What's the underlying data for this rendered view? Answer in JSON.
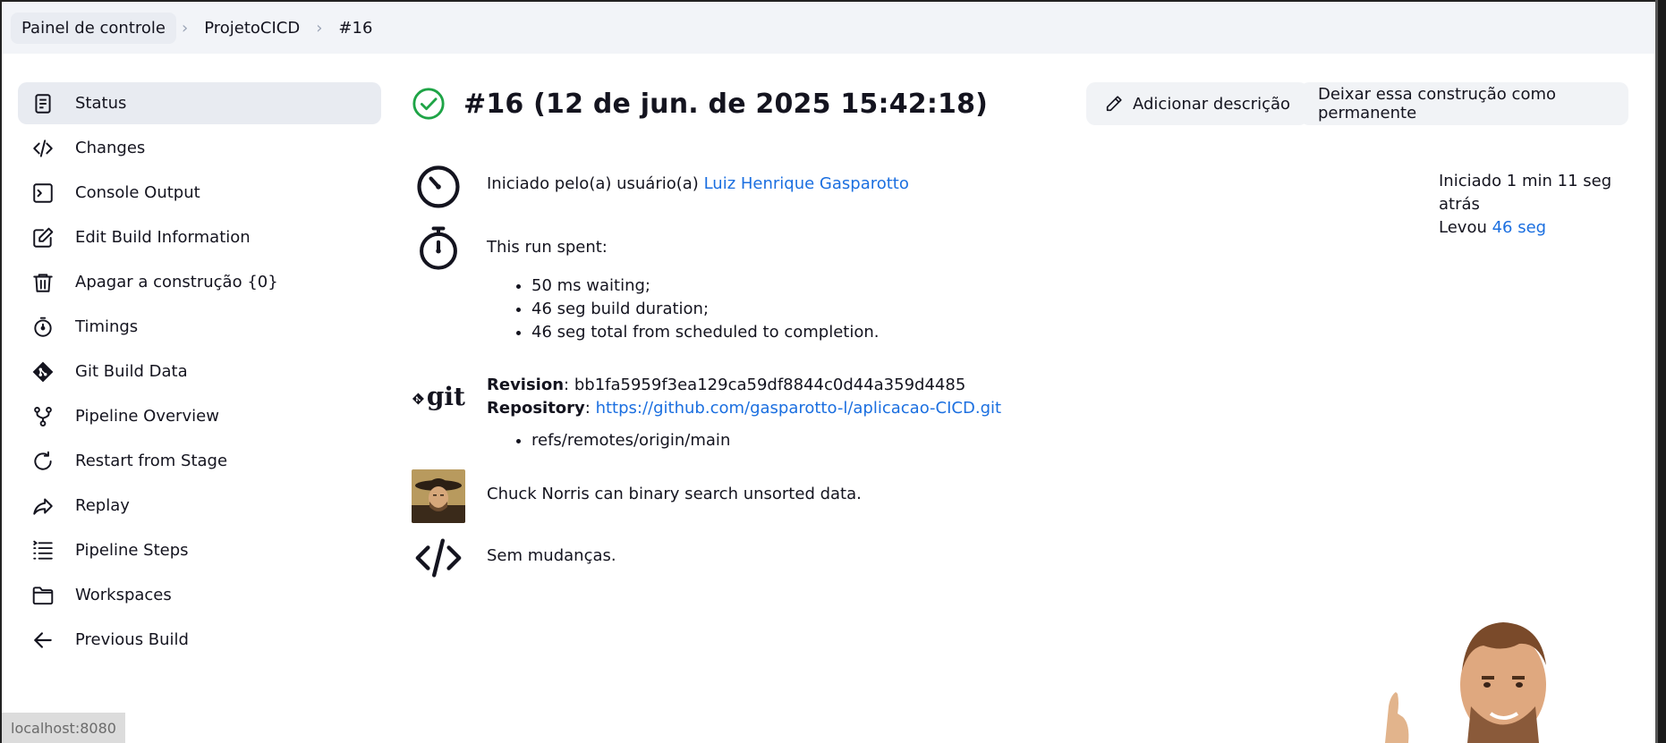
{
  "breadcrumb": {
    "items": [
      "Painel de controle",
      "ProjetoCICD",
      "#16"
    ]
  },
  "sidebar": {
    "items": [
      {
        "label": "Status",
        "icon": "status-doc-icon"
      },
      {
        "label": "Changes",
        "icon": "code-icon"
      },
      {
        "label": "Console Output",
        "icon": "terminal-icon"
      },
      {
        "label": "Edit Build Information",
        "icon": "edit-note-icon"
      },
      {
        "label": "Apagar a construção {0}",
        "icon": "trash-icon"
      },
      {
        "label": "Timings",
        "icon": "stopwatch-icon"
      },
      {
        "label": "Git Build Data",
        "icon": "git-diamond-icon"
      },
      {
        "label": "Pipeline Overview",
        "icon": "fork-icon"
      },
      {
        "label": "Restart from Stage",
        "icon": "refresh-icon"
      },
      {
        "label": "Replay",
        "icon": "share-arrow-icon"
      },
      {
        "label": "Pipeline Steps",
        "icon": "list-steps-icon"
      },
      {
        "label": "Workspaces",
        "icon": "folder-icon"
      },
      {
        "label": "Previous Build",
        "icon": "arrow-left-icon"
      }
    ]
  },
  "header": {
    "title": "#16 (12 de jun. de 2025 15:42:18)",
    "add_description": "Adicionar descrição",
    "keep_forever": "Deixar essa construção como permanente"
  },
  "info": {
    "started_by_prefix": "Iniciado pelo(a) usuário(a)",
    "started_by_user": "Luiz Henrique Gasparotto",
    "started_ago": "Iniciado 1 min 11 seg atrás",
    "took_prefix": "Levou",
    "took_value": "46 seg",
    "run_spent_label": "This run spent:",
    "run_spent_items": [
      "50 ms waiting;",
      "46 seg build duration;",
      "46 seg total from scheduled to completion."
    ],
    "git_logo_text": "git",
    "revision_label": "Revision",
    "revision_value": "bb1fa5959f3ea129ca59df8844c0d44a359d4485",
    "repository_label": "Repository",
    "repository_url": "https://github.com/gasparotto-l/aplicacao-CICD.git",
    "branches": [
      "refs/remotes/origin/main"
    ],
    "chuck_fact": "Chuck Norris can binary search unsorted data.",
    "no_changes": "Sem mudanças."
  },
  "status_bar": {
    "url": "localhost:8080"
  },
  "colors": {
    "accent_link": "#1b6fe0",
    "success_green": "#1ea446",
    "breadcrumb_bg": "#f2f4f8",
    "active_item_bg": "#e8ebf1"
  }
}
